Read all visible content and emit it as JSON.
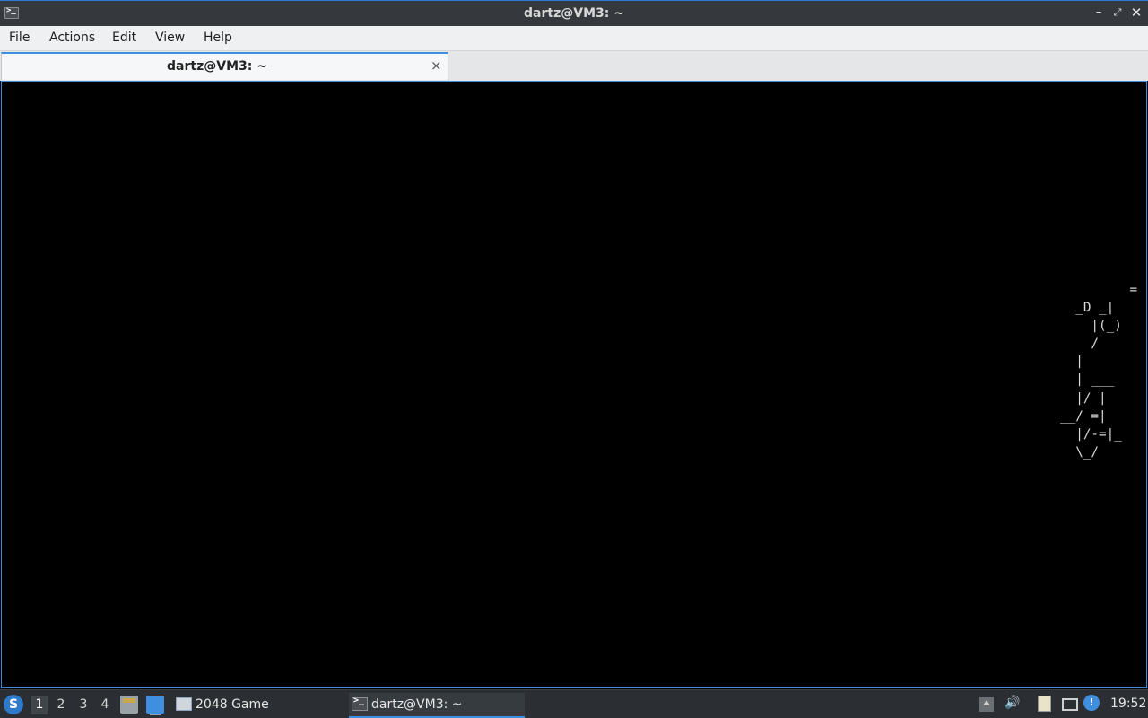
{
  "window": {
    "title": "dartz@VM3: ~",
    "controls": [
      "minimize",
      "maximize",
      "close"
    ]
  },
  "menubar": {
    "items": [
      "File",
      "Actions",
      "Edit",
      "View",
      "Help"
    ]
  },
  "tabs": [
    {
      "label": "dartz@VM3: ~",
      "close_glyph": "×"
    }
  ],
  "terminal": {
    "ascii_art": "         =\n  _D _|\n    |(_)\n    /\n  |\n  | ___\n  |/ |\n__/ =|\n  |/-=|_\n  \\_/"
  },
  "taskbar": {
    "workspaces": [
      "1",
      "2",
      "3",
      "4"
    ],
    "active_workspace": "1",
    "tasks": [
      {
        "label": "2048 Game"
      },
      {
        "label": "dartz@VM3: ~"
      }
    ],
    "clock": "19:52"
  },
  "colors": {
    "accent": "#3e8fe0",
    "titlebar_bg": "#35393d",
    "terminal_bg": "#000000",
    "taskbar_bg": "#2b2f33"
  }
}
